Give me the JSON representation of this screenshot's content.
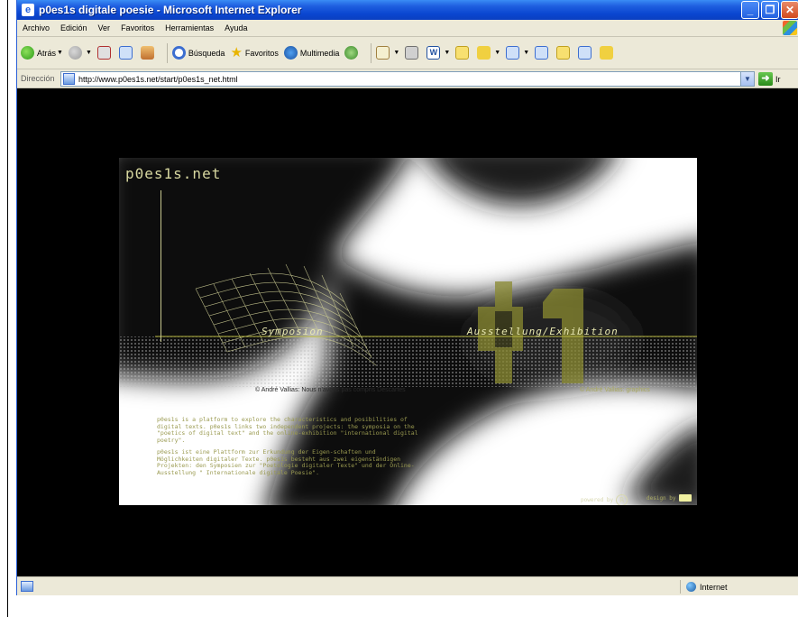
{
  "window": {
    "title": "p0es1s digitale poesie - Microsoft Internet Explorer"
  },
  "menu": [
    "Archivo",
    "Edición",
    "Ver",
    "Favoritos",
    "Herramientas",
    "Ayuda"
  ],
  "toolbar": {
    "back": "Atrás",
    "search": "Búsqueda",
    "favorites": "Favoritos",
    "media": "Multimedia"
  },
  "address": {
    "label": "Dirección",
    "url": "http://www.p0es1s.net/start/p0es1s_net.html",
    "go": "Ir"
  },
  "page": {
    "logo": "p0es1s.net",
    "link_symposion": "Symposion",
    "link_exhibition": "Ausstellung/Exhibition",
    "credit_left": "© André Vallias: Nous n'avons pas compris Descartes",
    "credit_right": "© André Vallias: graphics",
    "desc_en": "p0es1s is a platform to explore the characteristics and posibilities of digital texts. p0es1s links two independent projects: the symposia on the \"poetics of digital text\" and the online-exhibition \"international digital poetry\".",
    "desc_de": "p0es1s ist eine Plattform zur Erkundung der Eigen-schaften und Möglichkeiten digitaler Texte. p0es1s besteht aus zwei eigenständigen Projekten: den Symposien zur \"Poetologie digitaler Texte\" und der Online-Ausstellung \" Internationale digitale Poesie\".",
    "powered_by": "powered by",
    "powered_mark": "R",
    "design_by": "design by"
  },
  "status": {
    "zone": "Internet"
  },
  "colors": {
    "accent": "#0a46d0",
    "art_yellow": "#b8b840"
  }
}
